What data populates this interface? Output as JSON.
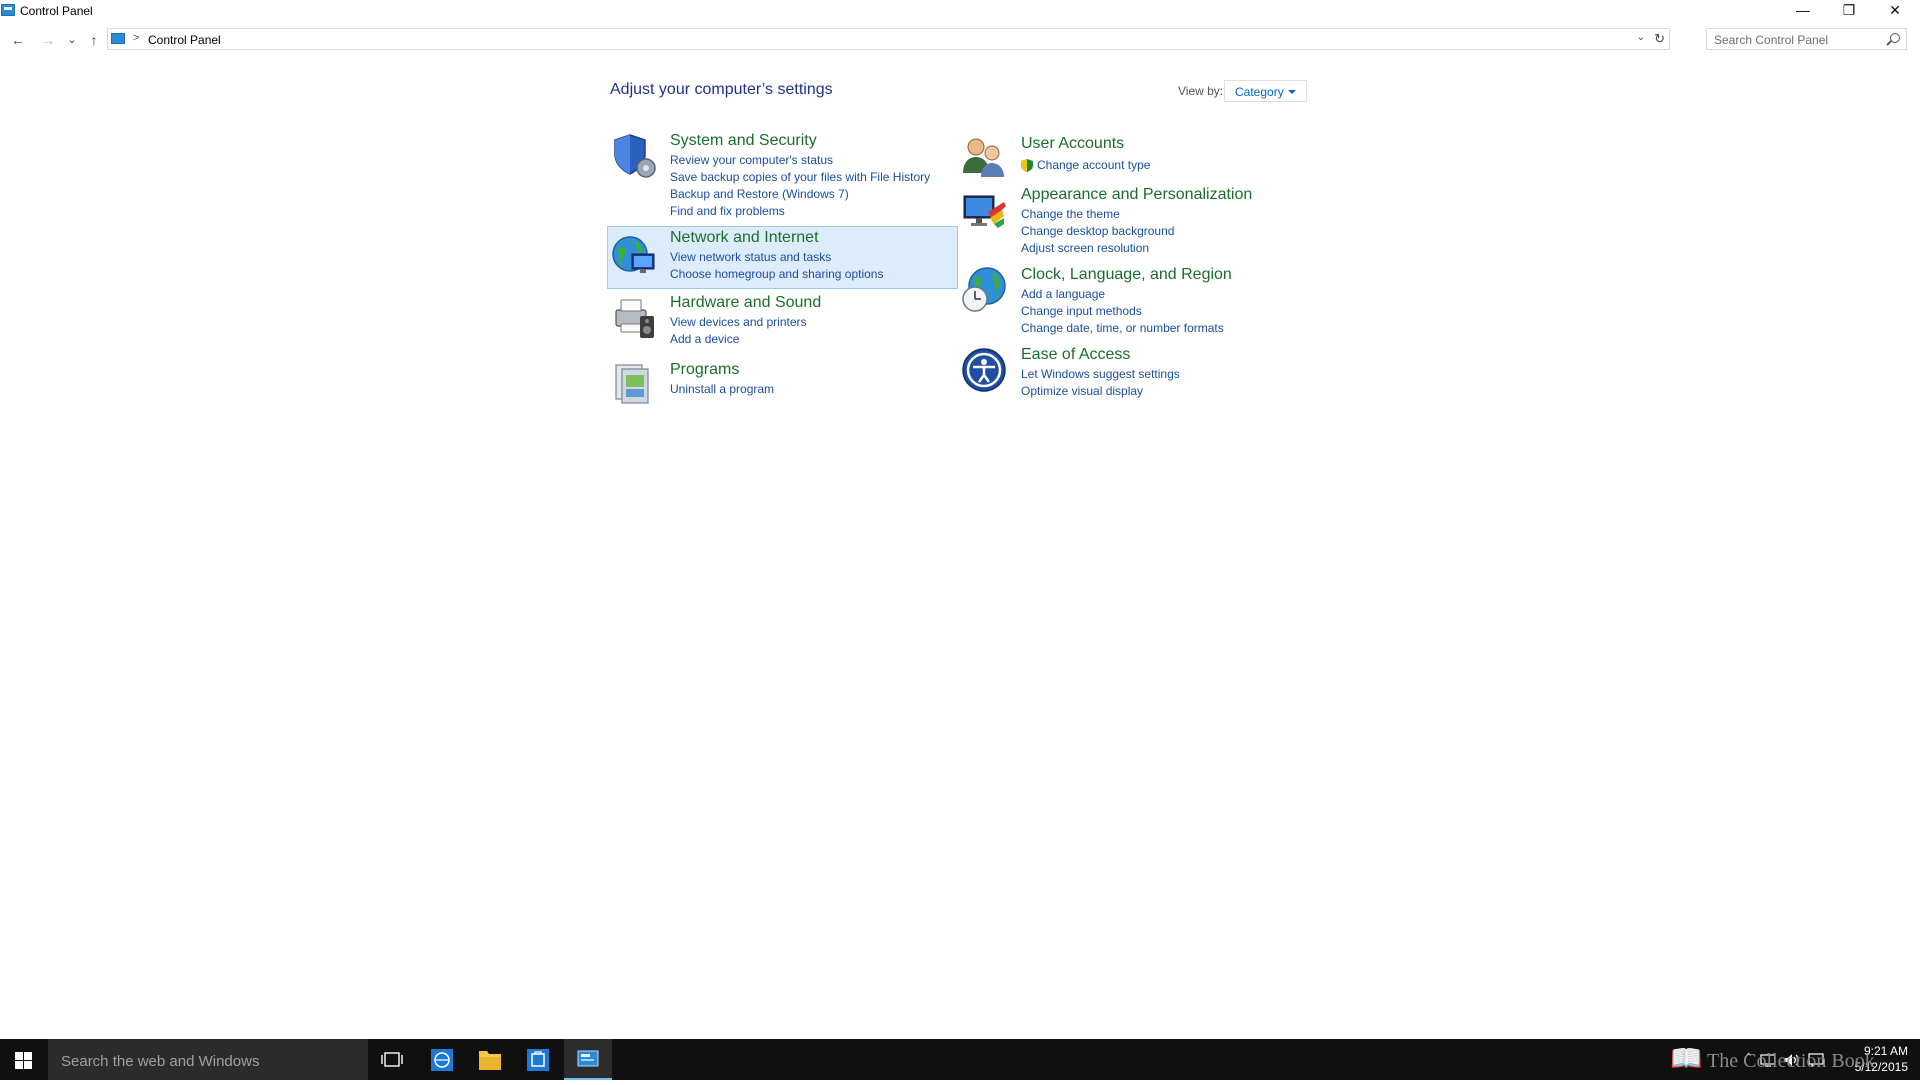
{
  "window": {
    "title": "Control Panel",
    "controls": {
      "minimize": "—",
      "restore": "❐",
      "close": "✕"
    }
  },
  "nav": {
    "back": "←",
    "forward": "→",
    "recent": "⌄",
    "up": "↑"
  },
  "address": {
    "separator": ">",
    "crumb": "Control Panel",
    "dropdown": "⌄",
    "refresh": "↻"
  },
  "search": {
    "placeholder": "Search Control Panel"
  },
  "main": {
    "heading": "Adjust your computer’s settings",
    "view_by": {
      "label": "View by:",
      "value": "Category"
    },
    "left_categories": [
      {
        "title": "System and Security",
        "icon": "shield-icon",
        "links": [
          "Review your computer's status",
          "Save backup copies of your files with File History",
          "Backup and Restore (Windows 7)",
          "Find and fix problems"
        ]
      },
      {
        "title": "Network and Internet",
        "icon": "network-globe-icon",
        "links": [
          "View network status and tasks",
          "Choose homegroup and sharing options"
        ]
      },
      {
        "title": "Hardware and Sound",
        "icon": "printer-speaker-icon",
        "links": [
          "View devices and printers",
          "Add a device"
        ]
      },
      {
        "title": "Programs",
        "icon": "programs-icon",
        "links": [
          "Uninstall a program"
        ]
      }
    ],
    "right_categories": [
      {
        "title": "User Accounts",
        "icon": "users-icon",
        "links": [
          "Change account type"
        ]
      },
      {
        "title": "Appearance and Personalization",
        "icon": "monitor-palette-icon",
        "links": [
          "Change the theme",
          "Change desktop background",
          "Adjust screen resolution"
        ]
      },
      {
        "title": "Clock, Language, and Region",
        "icon": "globe-clock-icon",
        "links": [
          "Add a language",
          "Change input methods",
          "Change date, time, or number formats"
        ]
      },
      {
        "title": "Ease of Access",
        "icon": "ease-of-access-icon",
        "links": [
          "Let Windows suggest settings",
          "Optimize visual display"
        ]
      }
    ]
  },
  "taskbar": {
    "search_placeholder": "Search the web and Windows",
    "watermark": "The Collection Book",
    "time": "9:21 AM",
    "date": "5/12/2015"
  }
}
